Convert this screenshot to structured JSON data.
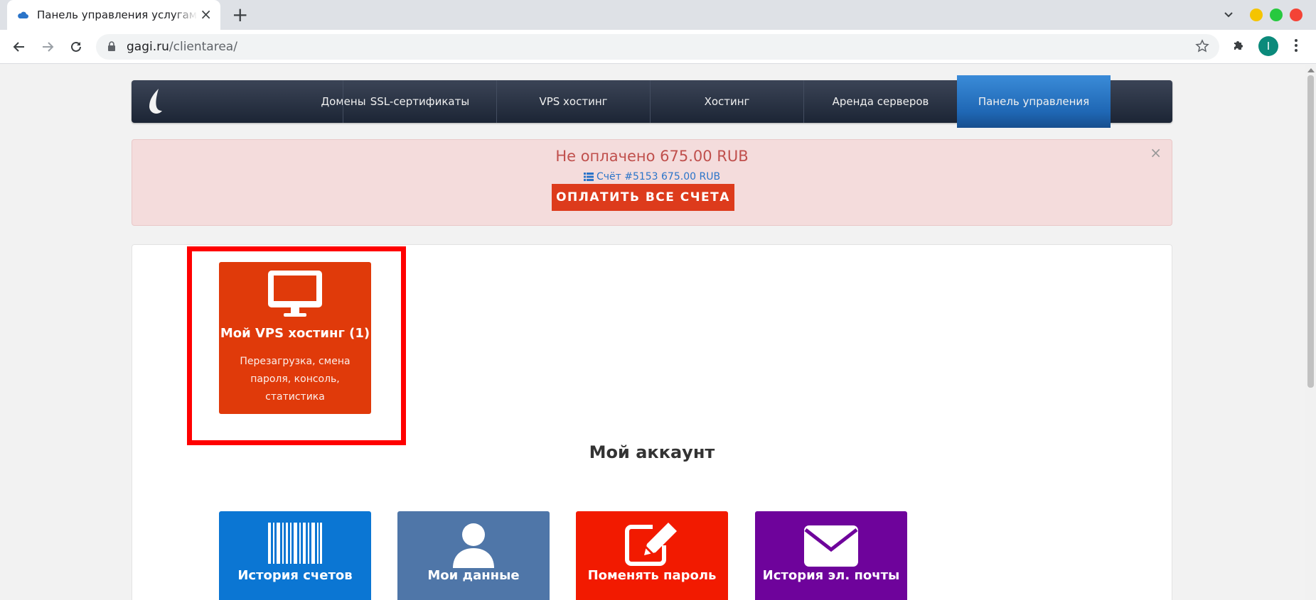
{
  "browser": {
    "tab_title": "Панель управления услугами",
    "url_host": "gagi.ru",
    "url_path": "/clientarea/",
    "avatar_letter": "I",
    "window_buttons": [
      "#f5c400",
      "#27c93f",
      "#f44336"
    ]
  },
  "nav": {
    "items": [
      "Домены",
      "SSL-сертификаты",
      "VPS хостинг",
      "Хостинг",
      "Аренда серверов",
      "Панель управления"
    ],
    "active": "Панель управления",
    "colors": {
      "bar": "#2b3446",
      "active": "#2a7bcd"
    }
  },
  "alert": {
    "message": "Не оплачено 675.00 RUB",
    "invoice": "Счёт #5153 675.00 RUB",
    "pay_button": "ОПЛАТИТЬ ВСЕ СЧЕТА",
    "close": "×",
    "colors": {
      "bg": "#f4dcdc",
      "text": "#c0504d",
      "button": "#dd3b1c"
    }
  },
  "services": {
    "vps": {
      "title": "Мой VPS хостинг (1)",
      "description": "Перезагрузка, смена пароля, консоль, статистика",
      "icon": "monitor-icon",
      "color": "#e03a0a",
      "highlighted": true
    }
  },
  "account": {
    "title": "Мой аккаунт",
    "tiles": [
      {
        "title": "История счетов",
        "icon": "barcode-icon",
        "color": "#0b76d3"
      },
      {
        "title": "Мои данные",
        "icon": "user-icon",
        "color": "#4f76a8"
      },
      {
        "title": "Поменять пароль",
        "icon": "edit-icon",
        "color": "#f21a00"
      },
      {
        "title": "История эл. почты",
        "icon": "envelope-icon",
        "color": "#6e039b"
      }
    ]
  }
}
